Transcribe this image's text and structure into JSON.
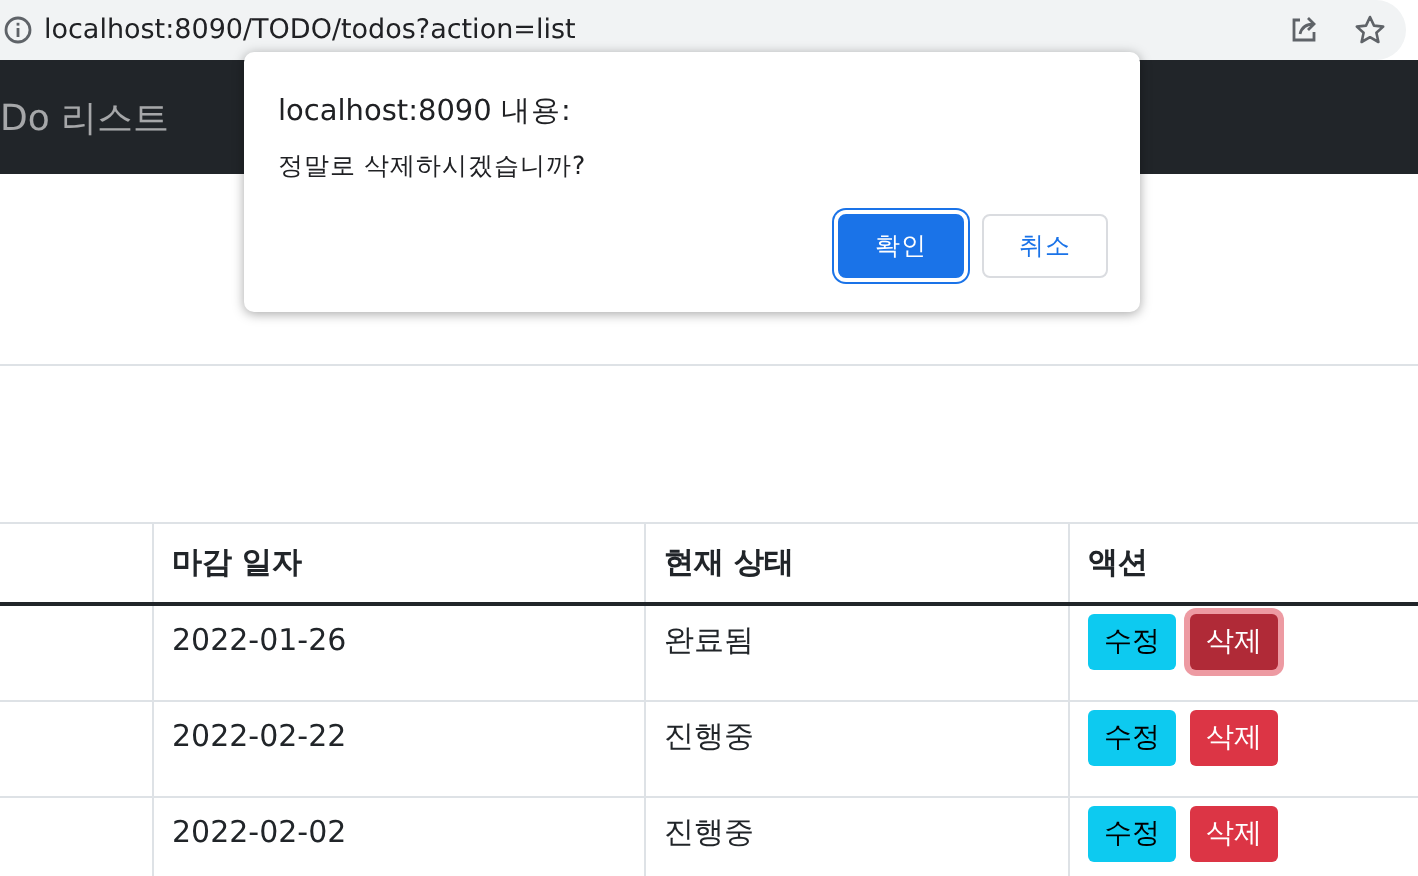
{
  "address_bar": {
    "url": "localhost:8090/TODO/todos?action=list"
  },
  "navbar": {
    "brand": "Do 리스트"
  },
  "table": {
    "columns": [
      "마감 일자",
      "현재 상태",
      "액션"
    ],
    "rows": [
      {
        "due_date": "2022-01-26",
        "status": "완료됨",
        "edit": "수정",
        "delete": "삭제",
        "delete_focused": true
      },
      {
        "due_date": "2022-02-22",
        "status": "진행중",
        "edit": "수정",
        "delete": "삭제",
        "delete_focused": false
      },
      {
        "due_date": "2022-02-02",
        "status": "진행중",
        "edit": "수정",
        "delete": "삭제",
        "delete_focused": false
      }
    ]
  },
  "dialog": {
    "title": "localhost:8090 내용:",
    "message": "정말로 삭제하시겠습니까?",
    "buttons": [
      {
        "label": "확인",
        "kind": "primary"
      },
      {
        "label": "취소",
        "kind": "secondary"
      }
    ]
  }
}
